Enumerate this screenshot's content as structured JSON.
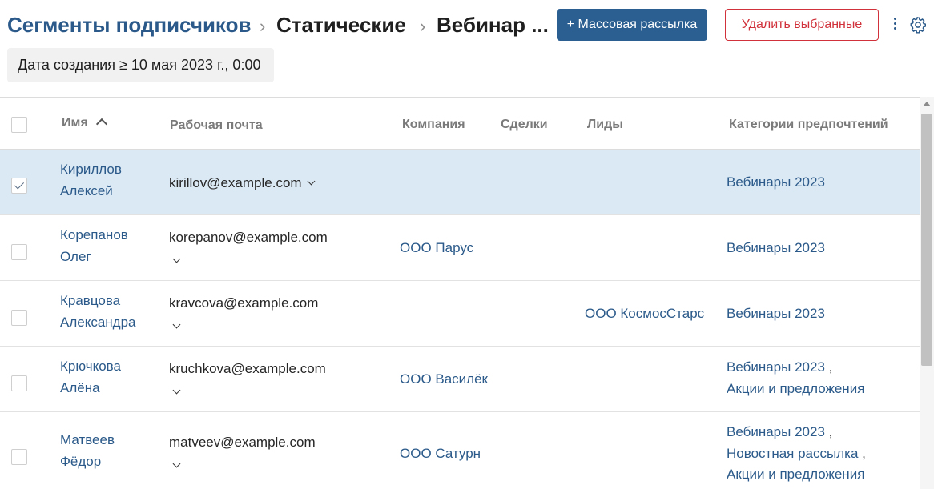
{
  "header": {
    "breadcrumb": [
      "Сегменты подписчиков",
      "Статические",
      "Вебинар ..."
    ],
    "separator": "›",
    "mass_mail_label": "+ Массовая рассылка",
    "delete_label": "Удалить выбранные"
  },
  "filter": {
    "label": "Дата создания ≥  10 мая 2023 г., 0:00"
  },
  "table": {
    "columns": {
      "name": "Имя",
      "email": "Рабочая почта",
      "company": "Компания",
      "deals": "Сделки",
      "leads": "Лиды",
      "categories": "Категории предпочтений"
    },
    "rows": [
      {
        "name_lines": [
          "Кириллов",
          "Алексей"
        ],
        "email": "kirillov@example.com",
        "company": "",
        "deals": "",
        "leads": "",
        "categories": [
          "Вебинары 2023"
        ],
        "checked": true
      },
      {
        "name_lines": [
          "Корепанов",
          "Олег"
        ],
        "email": "korepanov@example.com",
        "company": "ООО Парус",
        "deals": "",
        "leads": "",
        "categories": [
          "Вебинары 2023"
        ],
        "checked": false
      },
      {
        "name_lines": [
          "Кравцова",
          "Александра"
        ],
        "email": "kravcova@example.com",
        "company": "",
        "deals": "",
        "leads": "ООО КосмосСтарс",
        "categories": [
          "Вебинары 2023"
        ],
        "checked": false
      },
      {
        "name_lines": [
          "Крючкова",
          "Алёна"
        ],
        "email": "kruchkova@example.com",
        "company": "ООО Василёк",
        "deals": "",
        "leads": "",
        "categories": [
          "Вебинары 2023",
          "Акции и предложения"
        ],
        "checked": false
      },
      {
        "name_lines": [
          "Матвеев",
          "Фёдор"
        ],
        "email": "matveev@example.com",
        "company": "ООО Сатурн",
        "deals": "",
        "leads": "",
        "categories": [
          "Вебинары 2023",
          "Новостная рассылка",
          "Акции и предложения"
        ],
        "checked": false
      }
    ],
    "category_separator": " ,"
  },
  "colors": {
    "accent": "#2b5f91",
    "link": "#2b5a8a",
    "danger": "#d0313a",
    "selected_row": "#dbe9f4"
  },
  "icons": {
    "sort": "chevron-up-icon",
    "more": "kebab-menu-icon",
    "settings": "gear-icon",
    "expand": "chevron-down-icon"
  }
}
